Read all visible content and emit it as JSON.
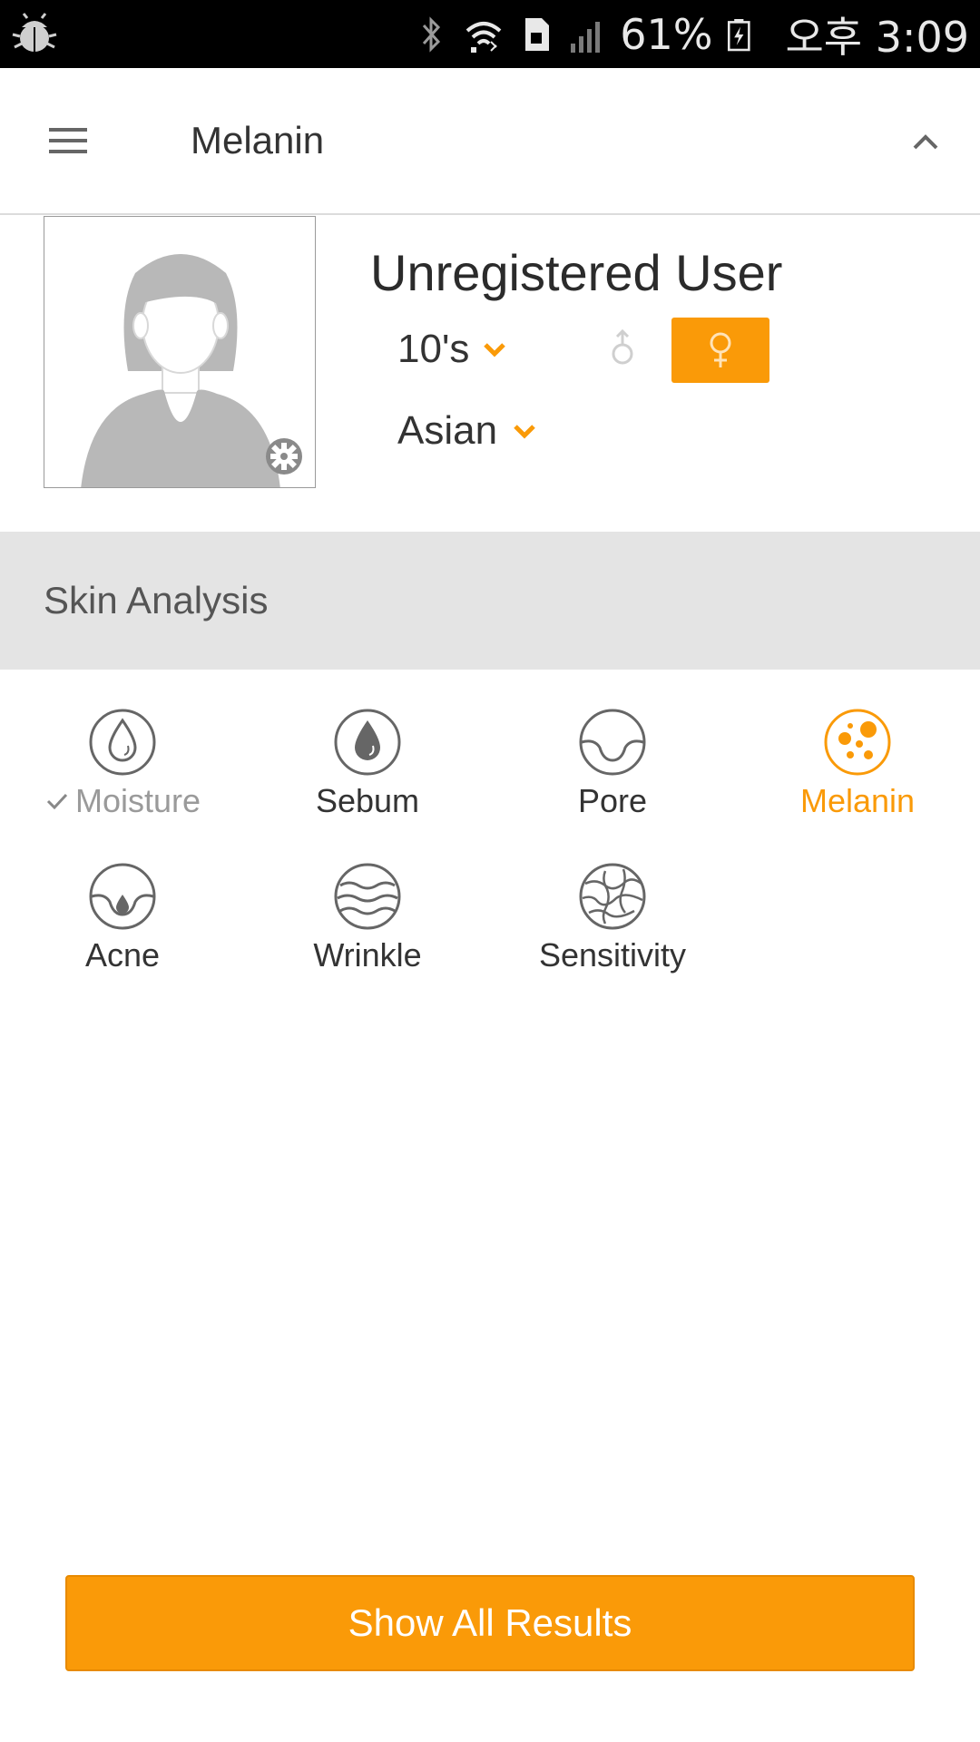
{
  "status_bar": {
    "battery_percent": "61%",
    "time": "오후 3:09",
    "icons": [
      "debug-bug-icon",
      "bluetooth-icon",
      "wifi-icon",
      "sim-card-icon",
      "signal-icon",
      "battery-charging-icon"
    ]
  },
  "app_bar": {
    "title": "Melanin",
    "menu_icon": "hamburger-menu-icon",
    "collapse_icon": "chevron-up-icon"
  },
  "profile": {
    "name": "Unregistered User",
    "age": "10's",
    "ethnicity": "Asian",
    "gender_selected": "female",
    "male_symbol": "♂",
    "female_symbol": "♀"
  },
  "section": {
    "title": "Skin Analysis"
  },
  "analysis_items": [
    {
      "label": "Moisture",
      "icon": "water-drop-outline-icon",
      "state": "done"
    },
    {
      "label": "Sebum",
      "icon": "oil-drop-icon",
      "state": "normal"
    },
    {
      "label": "Pore",
      "icon": "pore-icon",
      "state": "normal"
    },
    {
      "label": "Melanin",
      "icon": "melanin-dots-icon",
      "state": "active"
    },
    {
      "label": "Acne",
      "icon": "acne-icon",
      "state": "normal"
    },
    {
      "label": "Wrinkle",
      "icon": "wrinkle-waves-icon",
      "state": "normal"
    },
    {
      "label": "Sensitivity",
      "icon": "sensitivity-cracks-icon",
      "state": "normal"
    }
  ],
  "actions": {
    "show_all_label": "Show All Results"
  },
  "colors": {
    "accent": "#fa9a08",
    "section_bg": "#e4e4e4",
    "icon_gray": "#666666"
  }
}
